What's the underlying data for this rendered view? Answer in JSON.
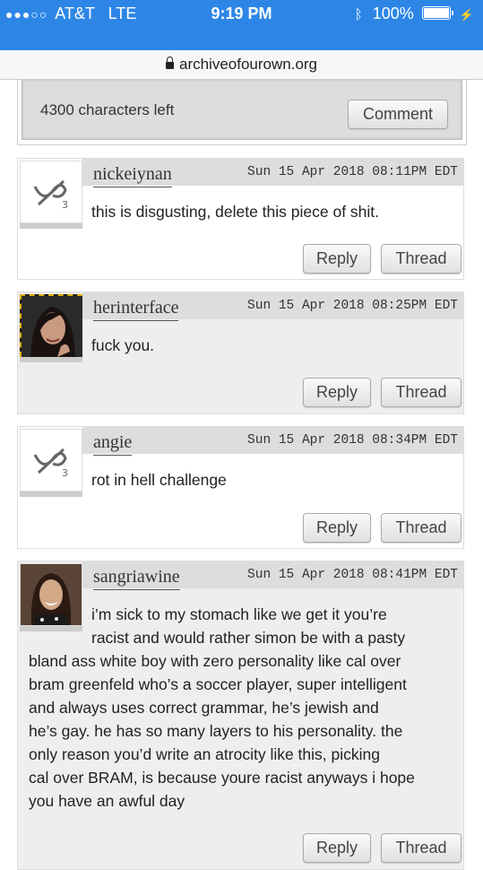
{
  "status_bar": {
    "carrier": "AT&T",
    "network": "LTE",
    "time": "9:19 PM",
    "battery": "100%"
  },
  "url_bar": {
    "domain": "archiveofourown.org"
  },
  "comment_form": {
    "chars_left": "4300 characters left",
    "submit_label": "Comment"
  },
  "comments": [
    {
      "author": "nickeiynan",
      "date": "Sun 15 Apr 2018 08:11PM EDT",
      "text": "this is disgusting, delete this piece of shit.",
      "reply_label": "Reply",
      "thread_label": "Thread",
      "avatar": "anonymous"
    },
    {
      "author": "herinterface",
      "date": "Sun 15 Apr 2018 08:25PM EDT",
      "text": "fuck you.",
      "reply_label": "Reply",
      "thread_label": "Thread",
      "avatar": "photo"
    },
    {
      "author": "angie",
      "date": "Sun 15 Apr 2018 08:34PM EDT",
      "text": "rot in hell challenge",
      "reply_label": "Reply",
      "thread_label": "Thread",
      "avatar": "anonymous"
    },
    {
      "author": "sangriawine",
      "date": "Sun 15 Apr 2018 08:41PM EDT",
      "lines": [
        "i’m sick to my stomach like we get it you’re",
        "racist and would rather simon be with a pasty",
        "bland ass white boy with zero personality like cal over",
        "bram greenfeld who’s a soccer player, super intelligent",
        "and always uses correct grammar, he’s jewish and",
        "he’s gay. he has so many layers to his personality. the",
        "only reason you’d write an atrocity like this, picking",
        "cal over BRAM, is because youre racist anyways i hope",
        "you have an awful day"
      ],
      "reply_label": "Reply",
      "thread_label": "Thread",
      "avatar": "photo"
    }
  ],
  "colors": {
    "status_blue": "#2d86e6",
    "comment_grey": "#eeeeee",
    "header_grey": "#dddddd"
  }
}
